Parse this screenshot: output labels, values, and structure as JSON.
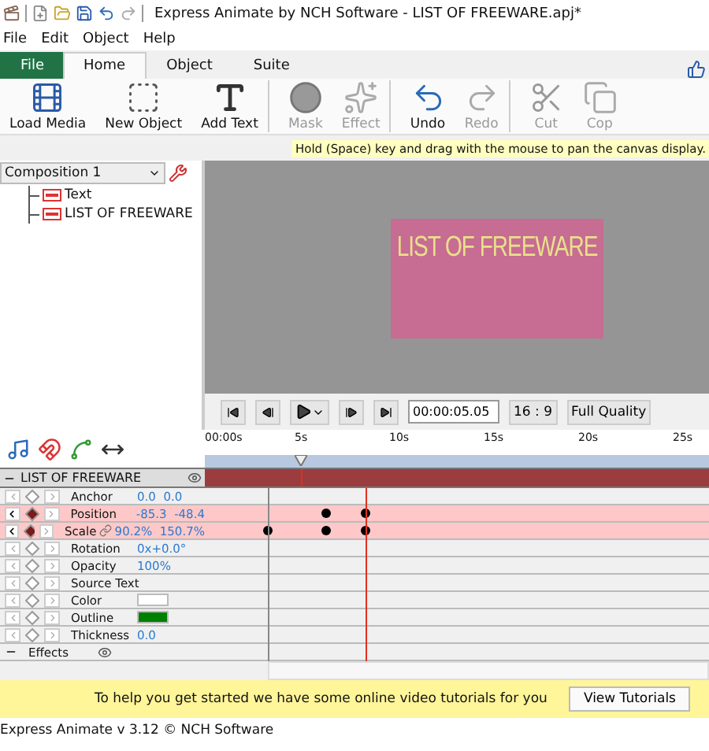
{
  "window": {
    "title": "Express Animate by NCH Software - LIST OF FREEWARE.apj*"
  },
  "menu": [
    "File",
    "Edit",
    "Object",
    "Help"
  ],
  "ribbon_tabs": [
    {
      "label": "File",
      "kind": "file",
      "selected": false
    },
    {
      "label": "Home",
      "kind": "tab",
      "selected": true
    },
    {
      "label": "Object",
      "kind": "tab",
      "selected": false
    },
    {
      "label": "Suite",
      "kind": "tab",
      "selected": false
    }
  ],
  "toolbar": [
    {
      "label": "Load Media",
      "kind": "load",
      "disabled": false,
      "group_end": false
    },
    {
      "label": "New Object",
      "kind": "object",
      "disabled": false,
      "group_end": false
    },
    {
      "label": "Add Text",
      "kind": "text",
      "disabled": false,
      "group_end": true
    },
    {
      "label": "Mask",
      "kind": "mask",
      "disabled": true,
      "group_end": false
    },
    {
      "label": "Effect",
      "kind": "effect",
      "disabled": true,
      "group_end": true
    },
    {
      "label": "Undo",
      "kind": "undo",
      "disabled": false,
      "group_end": false
    },
    {
      "label": "Redo",
      "kind": "redo",
      "disabled": true,
      "group_end": true
    },
    {
      "label": "Cut",
      "kind": "cut",
      "disabled": true,
      "group_end": false
    },
    {
      "label": "Cop",
      "kind": "copy",
      "disabled": true,
      "group_end": false
    }
  ],
  "hint": "Hold (Space) key and drag with the mouse to pan the canvas display.",
  "composition": {
    "value": "Composition 1"
  },
  "tree": [
    {
      "label": "Text"
    },
    {
      "label": "LIST OF FREEWARE"
    }
  ],
  "canvas": {
    "text": "LIST OF FREEWARE"
  },
  "playback": {
    "time": "00:00:05.05",
    "aspect": "16 : 9",
    "quality": "Full Quality"
  },
  "ruler": [
    "00:00s",
    "5s",
    "10s",
    "15s",
    "20s",
    "25s"
  ],
  "playhead": {
    "level": 0.19
  },
  "markers": [
    {
      "kind": "start",
      "level": 0.125
    },
    {
      "kind": "end",
      "level": 0.32
    }
  ],
  "layer": {
    "name": "LIST OF FREEWARE",
    "expanded": true
  },
  "properties": [
    {
      "name": "Anchor",
      "kind": "value",
      "value": "0.0  0.0",
      "animated": false
    },
    {
      "name": "Position",
      "kind": "value",
      "value": "-85.3  -48.4",
      "animated": true,
      "keyframes": [
        {
          "level": 0.24
        },
        {
          "level": 0.32
        }
      ]
    },
    {
      "name": "Scale",
      "kind": "linked",
      "value": "90.2%  150.7%",
      "animated": true,
      "keyframes": [
        {
          "level": 0.125
        },
        {
          "level": 0.24
        },
        {
          "level": 0.32
        }
      ]
    },
    {
      "name": "Rotation",
      "kind": "value",
      "value": "0x+0.0°",
      "animated": false
    },
    {
      "name": "Opacity",
      "kind": "value",
      "value": "100%",
      "animated": false
    },
    {
      "name": "Source Text",
      "kind": "plain",
      "animated": false
    },
    {
      "name": "Color",
      "kind": "swatch",
      "color": "#ffffff",
      "animated": false
    },
    {
      "name": "Outline",
      "kind": "swatch",
      "color": "#008000",
      "animated": false
    },
    {
      "name": "Thickness",
      "kind": "value",
      "value": "0.0",
      "animated": false
    }
  ],
  "effects": {
    "label": "Effects",
    "expanded": true
  },
  "banner": {
    "text": "To help you get started we have some online video tutorials for you",
    "button": "View Tutorials"
  },
  "status_bar": "Express Animate v 3.12 © NCH Software"
}
